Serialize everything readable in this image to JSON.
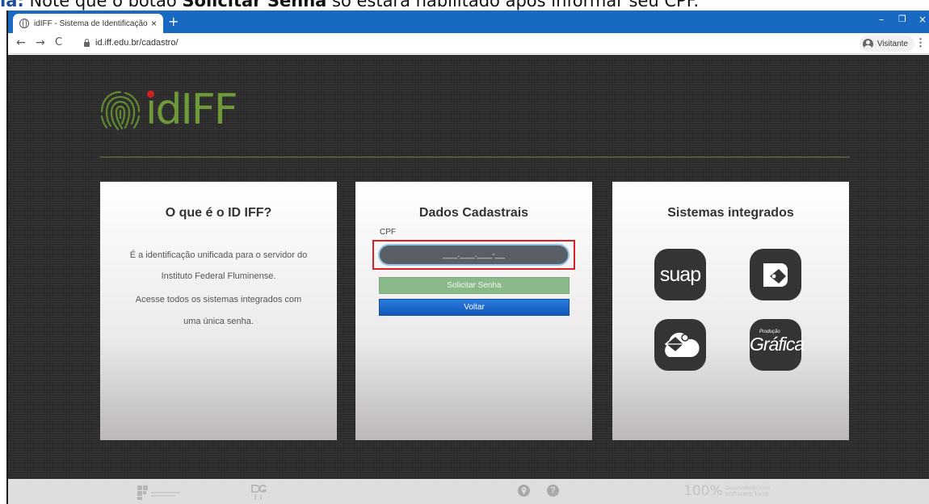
{
  "caption": {
    "prefix": "la:",
    "text_before": " Note que o botão ",
    "bold_term": "Solicitar Senha",
    "text_after": " só estará habilitado após informar seu CPF."
  },
  "browser": {
    "tab_title": "idIFF - Sistema de Identificação Ú",
    "tab_close": "×",
    "new_tab": "+",
    "url": "id.iff.edu.br/cadastro/",
    "profile_label": "Visitante",
    "minimize": "–",
    "restore": "❐",
    "close": "×"
  },
  "page": {
    "logo_text": "idIFF",
    "cards": {
      "about": {
        "title": "O que é o ID IFF?",
        "line1": "É a identificação unificada para o servidor do",
        "line2": "Instituto Federal Fluminense.",
        "line3": "Acesse todos os sistemas integrados com",
        "line4": "uma única senha."
      },
      "form": {
        "title": "Dados Cadastrais",
        "cpf_label": "CPF",
        "cpf_placeholder": "___.___.___-__",
        "cpf_value": "",
        "submit_label": "Solicitar Senha",
        "back_label": "Voltar"
      },
      "systems": {
        "title": "Sistemas integrados",
        "suap_label": "suap",
        "grafica_small": "Produção",
        "grafica_label": "Gráfica"
      }
    }
  },
  "footer": {
    "percent": "100%",
    "tagline1": "Desenvolvido com",
    "tagline2": "software livre",
    "map_icon": "?",
    "help_icon": "?"
  }
}
